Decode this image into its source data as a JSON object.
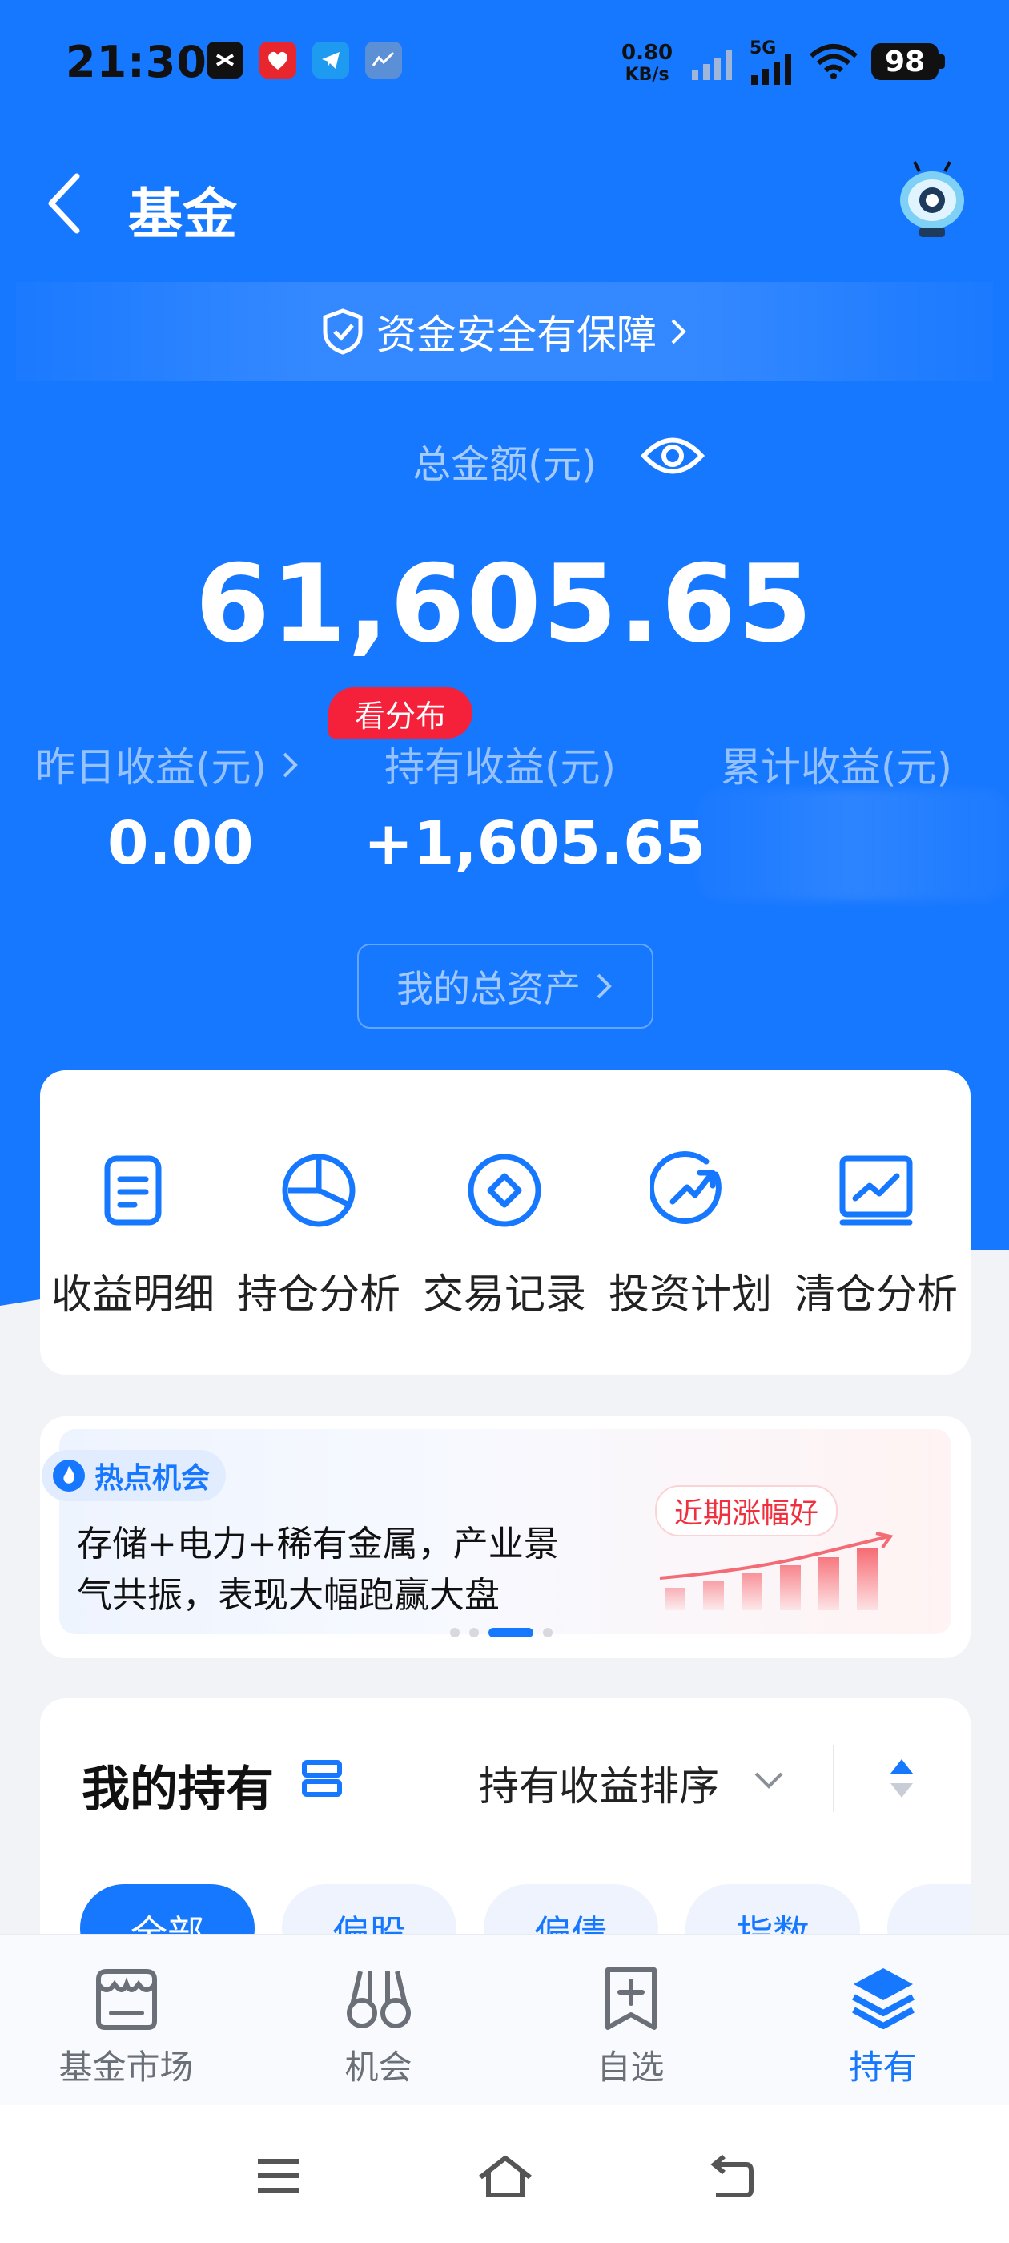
{
  "status_bar": {
    "time": "21:30",
    "net_speed_value": "0.80",
    "net_speed_unit": "KB/s",
    "network": "5G",
    "battery": "98"
  },
  "header": {
    "title": "基金",
    "safety_banner": "资金安全有保障",
    "total_label": "总金额(元)",
    "total_amount": "61,605.65",
    "see_distribution": "看分布"
  },
  "earnings": {
    "yesterday_label": "昨日收益(元)",
    "yesterday_value": "0.00",
    "holding_label": "持有收益(元)",
    "holding_value": "+1,605.65",
    "cumulative_label": "累计收益(元)"
  },
  "total_assets_button": "我的总资产",
  "quick_actions": [
    {
      "label": "收益明细",
      "icon": "document-icon"
    },
    {
      "label": "持仓分析",
      "icon": "pie-chart-icon"
    },
    {
      "label": "交易记录",
      "icon": "diamond-circle-icon"
    },
    {
      "label": "投资计划",
      "icon": "growth-arrow-icon"
    },
    {
      "label": "清仓分析",
      "icon": "trend-board-icon"
    }
  ],
  "hot_opportunity": {
    "tag": "热点机会",
    "line1": "存储+电力+稀有金属，产业景",
    "line2": "气共振，表现大幅跑赢大盘",
    "badge": "近期涨幅好"
  },
  "holdings": {
    "title": "我的持有",
    "sort_label": "持有收益排序",
    "filters": [
      "全部",
      "偏股",
      "偏债",
      "指数"
    ]
  },
  "bottom_nav": [
    {
      "label": "基金市场",
      "icon": "store-icon"
    },
    {
      "label": "机会",
      "icon": "binoculars-icon"
    },
    {
      "label": "自选",
      "icon": "bookmark-add-icon"
    },
    {
      "label": "持有",
      "icon": "layers-icon",
      "active": true
    }
  ],
  "colors": {
    "brand_blue": "#1677ff",
    "alert_red": "#f5213a"
  }
}
